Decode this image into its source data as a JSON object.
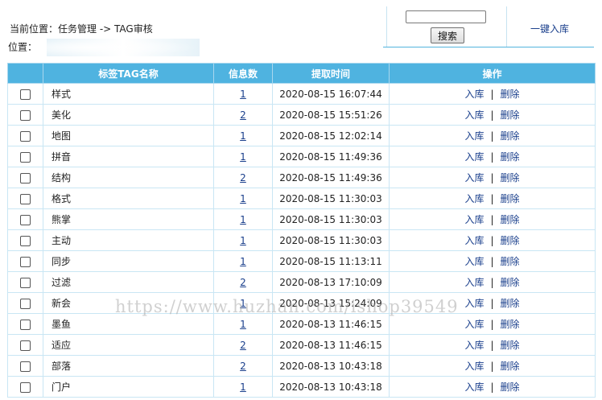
{
  "breadcrumb": "当前位置：任务管理 -> TAG审核",
  "location_label": "位置：",
  "search": {
    "value": "",
    "placeholder": "",
    "button_label": "搜索"
  },
  "onekey_label": "一键入库",
  "table": {
    "columns": [
      "",
      "标签TAG名称",
      "信息数",
      "提取时间",
      "操作"
    ],
    "op_labels": {
      "accept": "入库",
      "separator": "|",
      "delete": "删除"
    },
    "rows": [
      {
        "name": "样式",
        "count": "1",
        "time": "2020-08-15 16:07:44"
      },
      {
        "name": "美化",
        "count": "2",
        "time": "2020-08-15 15:51:26"
      },
      {
        "name": "地图",
        "count": "1",
        "time": "2020-08-15 12:02:14"
      },
      {
        "name": "拼音",
        "count": "1",
        "time": "2020-08-15 11:49:36"
      },
      {
        "name": "结构",
        "count": "2",
        "time": "2020-08-15 11:49:36"
      },
      {
        "name": "格式",
        "count": "1",
        "time": "2020-08-15 11:30:03"
      },
      {
        "name": "熊掌",
        "count": "1",
        "time": "2020-08-15 11:30:03"
      },
      {
        "name": "主动",
        "count": "1",
        "time": "2020-08-15 11:30:03"
      },
      {
        "name": "同步",
        "count": "1",
        "time": "2020-08-15 11:13:11"
      },
      {
        "name": "过滤",
        "count": "2",
        "time": "2020-08-13 17:10:09"
      },
      {
        "name": "新会",
        "count": "1",
        "time": "2020-08-13 15:24:09"
      },
      {
        "name": "墨鱼",
        "count": "1",
        "time": "2020-08-13 11:46:15"
      },
      {
        "name": "适应",
        "count": "2",
        "time": "2020-08-13 11:46:15"
      },
      {
        "name": "部落",
        "count": "2",
        "time": "2020-08-13 10:43:18"
      },
      {
        "name": "门户",
        "count": "1",
        "time": "2020-08-13 10:43:18"
      }
    ]
  },
  "watermark": "https://www.huzhan.com/ishop39549",
  "colors": {
    "header_bg": "#4fb3e0",
    "link": "#1a3f8c",
    "border": "#c9e6f4"
  }
}
